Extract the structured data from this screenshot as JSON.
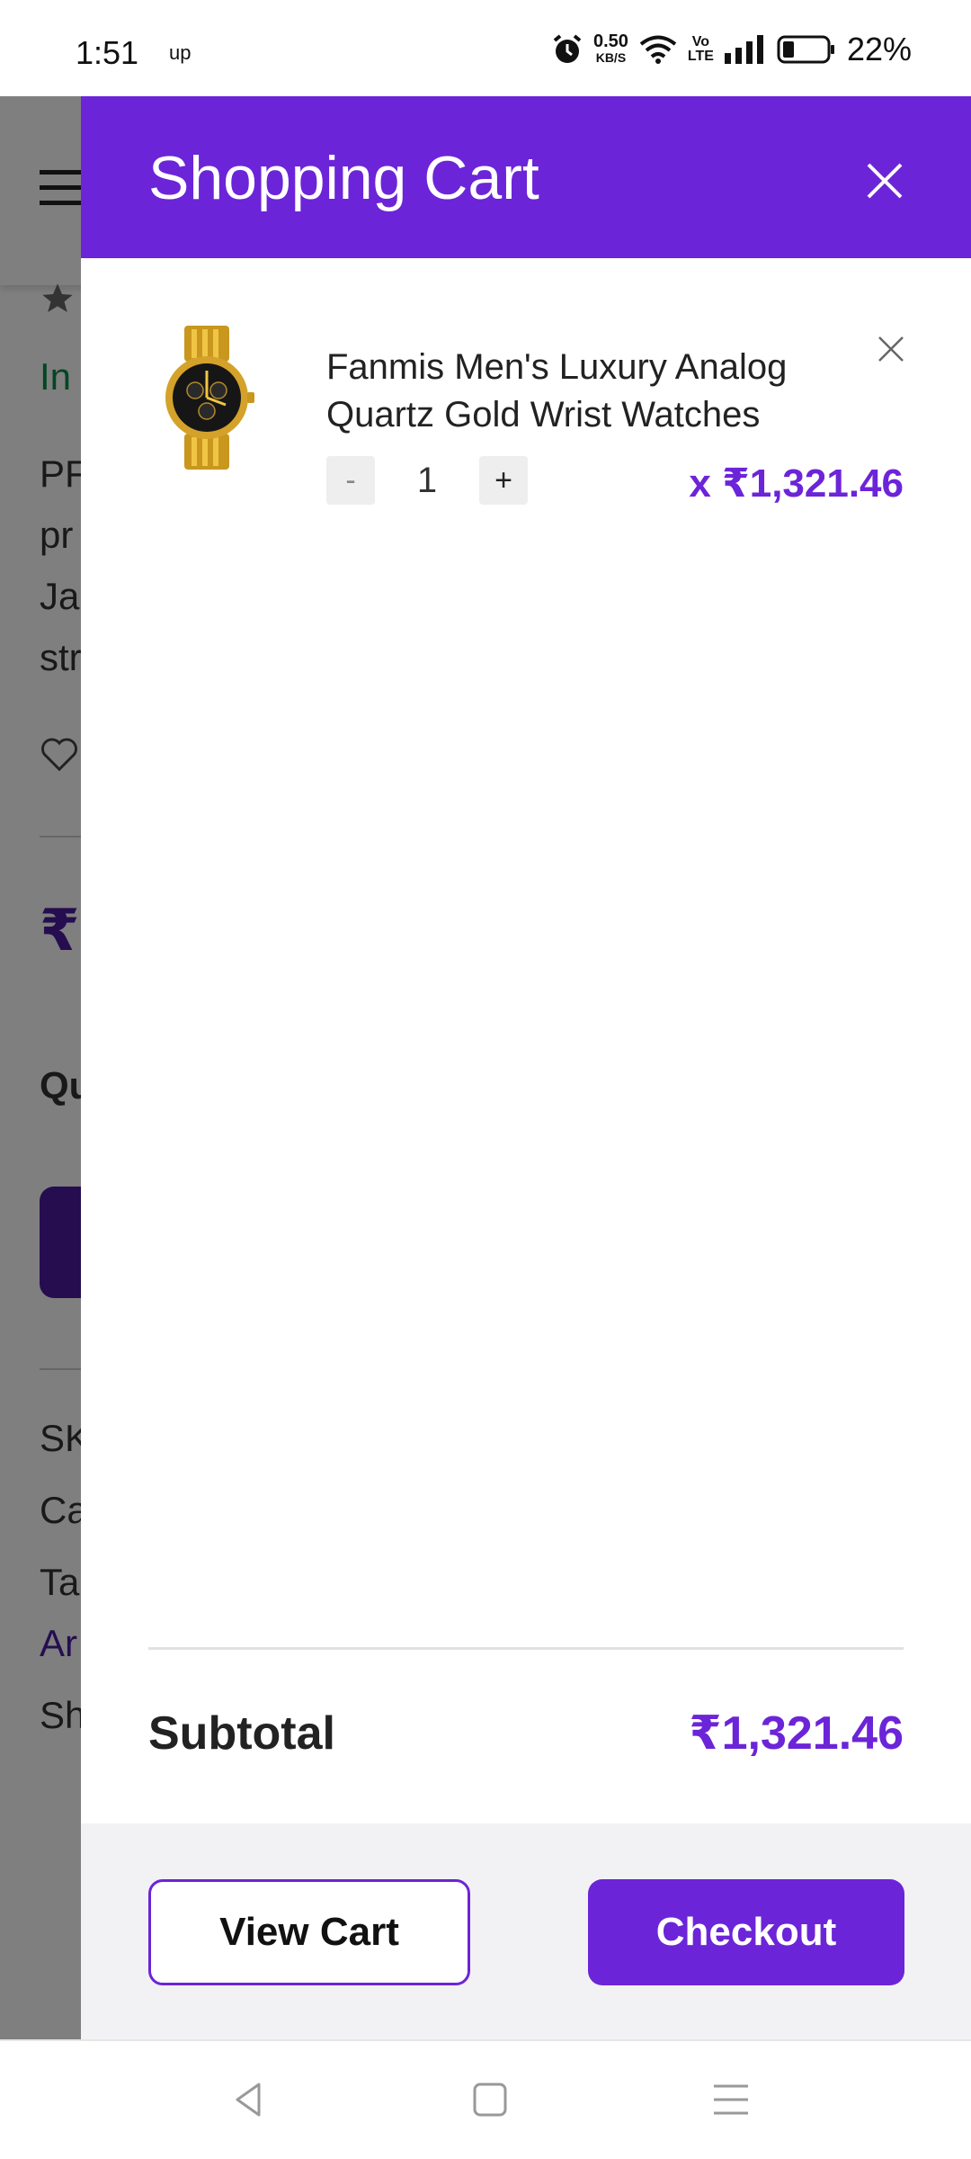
{
  "status_bar": {
    "time": "1:51",
    "network_speed": "0.50",
    "network_unit": "KB/S",
    "volte_top": "Vo",
    "volte_bottom": "LTE",
    "battery": "22%",
    "up_label": "up"
  },
  "background_page": {
    "snippets": [
      "In",
      "PF",
      "pr",
      "Ja",
      "str",
      "₹",
      "Qu",
      "SK",
      "Ca",
      "Ta",
      "Ar",
      "Sh"
    ]
  },
  "cart": {
    "title": "Shopping Cart",
    "items": [
      {
        "name": "Fanmis Men's Luxury Analog Quartz Gold Wrist Watches",
        "quantity": "1",
        "minus_label": "-",
        "plus_label": "+",
        "price": "x ₹1,321.46"
      }
    ],
    "subtotal_label": "Subtotal",
    "subtotal_value": "₹1,321.46",
    "view_cart_label": "View Cart",
    "checkout_label": "Checkout"
  },
  "colors": {
    "accent": "#6c24d8",
    "footer_bg": "#f2f2f4"
  },
  "icons": [
    "close-icon",
    "remove-item-icon",
    "watch-thumbnail",
    "alarm-icon",
    "wifi-icon",
    "signal-icon",
    "battery-icon",
    "back-icon",
    "home-icon",
    "menu-icon",
    "hamburger-icon",
    "star-icon",
    "heart-icon"
  ]
}
